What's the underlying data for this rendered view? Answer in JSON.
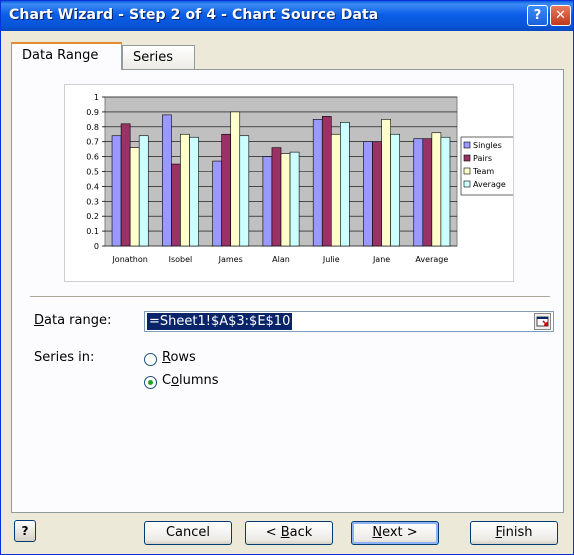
{
  "window": {
    "title": "Chart Wizard - Step 2 of 4 - Chart Source Data"
  },
  "tabs": [
    {
      "label": "Data Range",
      "active": true
    },
    {
      "label": "Series",
      "active": false
    }
  ],
  "form": {
    "data_range_label": "Data range:",
    "data_range_value": "=Sheet1!$A$3:$E$10",
    "series_in_label": "Series in:",
    "options": [
      {
        "label": "Rows",
        "selected": false
      },
      {
        "label": "Columns",
        "selected": true
      }
    ]
  },
  "buttons": {
    "help": "?",
    "cancel": "Cancel",
    "back": "< Back",
    "next": "Next >",
    "finish": "Finish"
  },
  "chart_data": {
    "type": "bar",
    "categories": [
      "Jonathon",
      "Isobel",
      "James",
      "Alan",
      "Julie",
      "Jane",
      "Average"
    ],
    "series": [
      {
        "name": "Singles",
        "color": "#9999ff",
        "values": [
          0.74,
          0.88,
          0.57,
          0.6,
          0.85,
          0.7,
          0.72
        ]
      },
      {
        "name": "Pairs",
        "color": "#993366",
        "values": [
          0.82,
          0.55,
          0.75,
          0.66,
          0.87,
          0.7,
          0.72
        ]
      },
      {
        "name": "Team",
        "color": "#ffffcc",
        "values": [
          0.66,
          0.75,
          0.9,
          0.62,
          0.75,
          0.85,
          0.76
        ]
      },
      {
        "name": "Average",
        "color": "#ccffff",
        "values": [
          0.74,
          0.73,
          0.74,
          0.63,
          0.83,
          0.75,
          0.73
        ]
      }
    ],
    "ylim": [
      0,
      1
    ],
    "yticks": [
      "0",
      "0.1",
      "0.2",
      "0.3",
      "0.4",
      "0.5",
      "0.6",
      "0.7",
      "0.8",
      "0.9",
      "1"
    ],
    "plot_background": "#c0c0c0",
    "grid": true,
    "legend": "right"
  }
}
